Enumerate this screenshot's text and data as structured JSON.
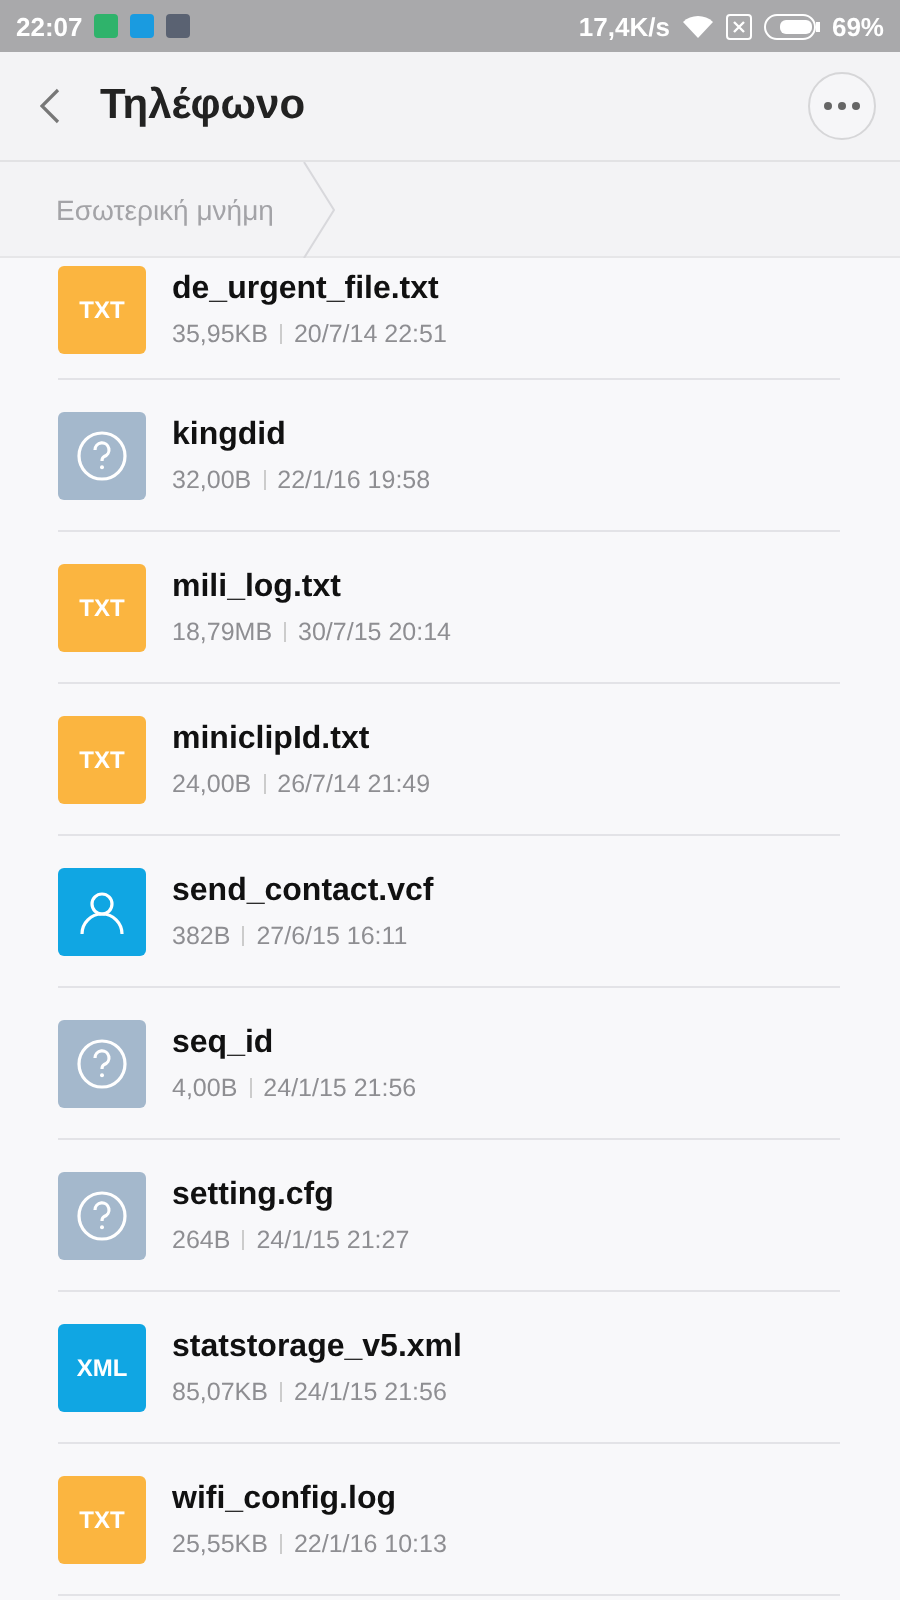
{
  "status_bar": {
    "time": "22:07",
    "app_icons": [
      {
        "color": "#2fb36b"
      },
      {
        "color": "#1a9be0"
      },
      {
        "color": "#5a6272"
      }
    ],
    "speed": "17,4K/s",
    "battery": "69%"
  },
  "header": {
    "title": "Τηλέφωνο"
  },
  "breadcrumb": [
    {
      "label": "Εσωτερική μνήμη"
    }
  ],
  "files": [
    {
      "name": "de_urgent_file.txt",
      "size": "35,95KB",
      "date": "20/7/14 22:51",
      "kind": "badge",
      "badge": "TXT",
      "color": "#fbb540"
    },
    {
      "name": "kingdid",
      "size": "32,00B",
      "date": "22/1/16 19:58",
      "kind": "unknown",
      "color": "#a4b8cc"
    },
    {
      "name": "mili_log.txt",
      "size": "18,79MB",
      "date": "30/7/15 20:14",
      "kind": "badge",
      "badge": "TXT",
      "color": "#fbb540"
    },
    {
      "name": "miniclipId.txt",
      "size": "24,00B",
      "date": "26/7/14 21:49",
      "kind": "badge",
      "badge": "TXT",
      "color": "#fbb540"
    },
    {
      "name": "send_contact.vcf",
      "size": "382B",
      "date": "27/6/15 16:11",
      "kind": "contact",
      "color": "#10a6e3"
    },
    {
      "name": "seq_id",
      "size": "4,00B",
      "date": "24/1/15 21:56",
      "kind": "unknown",
      "color": "#a4b8cc"
    },
    {
      "name": "setting.cfg",
      "size": "264B",
      "date": "24/1/15 21:27",
      "kind": "unknown",
      "color": "#a4b8cc"
    },
    {
      "name": "statstorage_v5.xml",
      "size": "85,07KB",
      "date": "24/1/15 21:56",
      "kind": "badge",
      "badge": "XML",
      "color": "#10a6e3"
    },
    {
      "name": "wifi_config.log",
      "size": "25,55KB",
      "date": "22/1/16 10:13",
      "kind": "badge",
      "badge": "TXT",
      "color": "#fbb540"
    }
  ]
}
